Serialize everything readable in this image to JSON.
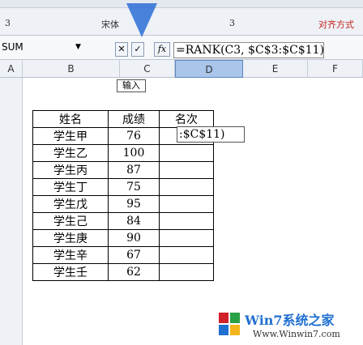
{
  "ribbon": {
    "cell_a": "3",
    "cell_b": "宋体",
    "cell_c": "3",
    "cell_d": "对齐方式"
  },
  "formula_bar": {
    "name_box": "SUM",
    "cancel_label": "✕",
    "enter_label": "✓",
    "fx_label": "fx",
    "formula": "=RANK(C3, $C$3:$C$11)"
  },
  "columns": [
    "A",
    "B",
    "C",
    "D",
    "E",
    "F"
  ],
  "tooltip": "输入",
  "editing_text": ":$C$11)",
  "table": {
    "headers": [
      "姓名",
      "成绩",
      "名次"
    ],
    "rows": [
      {
        "name": "学生甲",
        "score": "76"
      },
      {
        "name": "学生乙",
        "score": "100"
      },
      {
        "name": "学生丙",
        "score": "87"
      },
      {
        "name": "学生丁",
        "score": "75"
      },
      {
        "name": "学生戊",
        "score": "95"
      },
      {
        "name": "学生己",
        "score": "84"
      },
      {
        "name": "学生庚",
        "score": "90"
      },
      {
        "name": "学生辛",
        "score": "67"
      },
      {
        "name": "学生壬",
        "score": "62"
      }
    ]
  },
  "watermark": {
    "brand": "Win7系统之家",
    "url": "Www.Winwin7.com"
  },
  "colors": {
    "arrow": "#2b6fd6",
    "brand_red": "#d0202a",
    "brand_blue": "#1f6fd0"
  }
}
